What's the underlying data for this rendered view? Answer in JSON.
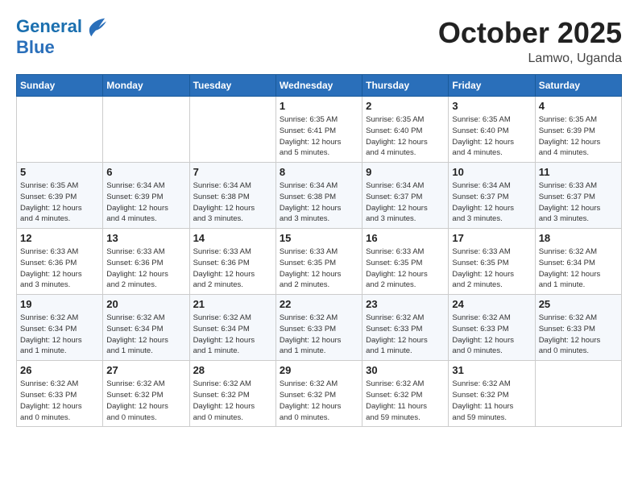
{
  "header": {
    "logo_line1": "General",
    "logo_line2": "Blue",
    "month": "October 2025",
    "location": "Lamwo, Uganda"
  },
  "days_of_week": [
    "Sunday",
    "Monday",
    "Tuesday",
    "Wednesday",
    "Thursday",
    "Friday",
    "Saturday"
  ],
  "weeks": [
    [
      {
        "day": "",
        "info": ""
      },
      {
        "day": "",
        "info": ""
      },
      {
        "day": "",
        "info": ""
      },
      {
        "day": "1",
        "info": "Sunrise: 6:35 AM\nSunset: 6:41 PM\nDaylight: 12 hours\nand 5 minutes."
      },
      {
        "day": "2",
        "info": "Sunrise: 6:35 AM\nSunset: 6:40 PM\nDaylight: 12 hours\nand 4 minutes."
      },
      {
        "day": "3",
        "info": "Sunrise: 6:35 AM\nSunset: 6:40 PM\nDaylight: 12 hours\nand 4 minutes."
      },
      {
        "day": "4",
        "info": "Sunrise: 6:35 AM\nSunset: 6:39 PM\nDaylight: 12 hours\nand 4 minutes."
      }
    ],
    [
      {
        "day": "5",
        "info": "Sunrise: 6:35 AM\nSunset: 6:39 PM\nDaylight: 12 hours\nand 4 minutes."
      },
      {
        "day": "6",
        "info": "Sunrise: 6:34 AM\nSunset: 6:39 PM\nDaylight: 12 hours\nand 4 minutes."
      },
      {
        "day": "7",
        "info": "Sunrise: 6:34 AM\nSunset: 6:38 PM\nDaylight: 12 hours\nand 3 minutes."
      },
      {
        "day": "8",
        "info": "Sunrise: 6:34 AM\nSunset: 6:38 PM\nDaylight: 12 hours\nand 3 minutes."
      },
      {
        "day": "9",
        "info": "Sunrise: 6:34 AM\nSunset: 6:37 PM\nDaylight: 12 hours\nand 3 minutes."
      },
      {
        "day": "10",
        "info": "Sunrise: 6:34 AM\nSunset: 6:37 PM\nDaylight: 12 hours\nand 3 minutes."
      },
      {
        "day": "11",
        "info": "Sunrise: 6:33 AM\nSunset: 6:37 PM\nDaylight: 12 hours\nand 3 minutes."
      }
    ],
    [
      {
        "day": "12",
        "info": "Sunrise: 6:33 AM\nSunset: 6:36 PM\nDaylight: 12 hours\nand 3 minutes."
      },
      {
        "day": "13",
        "info": "Sunrise: 6:33 AM\nSunset: 6:36 PM\nDaylight: 12 hours\nand 2 minutes."
      },
      {
        "day": "14",
        "info": "Sunrise: 6:33 AM\nSunset: 6:36 PM\nDaylight: 12 hours\nand 2 minutes."
      },
      {
        "day": "15",
        "info": "Sunrise: 6:33 AM\nSunset: 6:35 PM\nDaylight: 12 hours\nand 2 minutes."
      },
      {
        "day": "16",
        "info": "Sunrise: 6:33 AM\nSunset: 6:35 PM\nDaylight: 12 hours\nand 2 minutes."
      },
      {
        "day": "17",
        "info": "Sunrise: 6:33 AM\nSunset: 6:35 PM\nDaylight: 12 hours\nand 2 minutes."
      },
      {
        "day": "18",
        "info": "Sunrise: 6:32 AM\nSunset: 6:34 PM\nDaylight: 12 hours\nand 1 minute."
      }
    ],
    [
      {
        "day": "19",
        "info": "Sunrise: 6:32 AM\nSunset: 6:34 PM\nDaylight: 12 hours\nand 1 minute."
      },
      {
        "day": "20",
        "info": "Sunrise: 6:32 AM\nSunset: 6:34 PM\nDaylight: 12 hours\nand 1 minute."
      },
      {
        "day": "21",
        "info": "Sunrise: 6:32 AM\nSunset: 6:34 PM\nDaylight: 12 hours\nand 1 minute."
      },
      {
        "day": "22",
        "info": "Sunrise: 6:32 AM\nSunset: 6:33 PM\nDaylight: 12 hours\nand 1 minute."
      },
      {
        "day": "23",
        "info": "Sunrise: 6:32 AM\nSunset: 6:33 PM\nDaylight: 12 hours\nand 1 minute."
      },
      {
        "day": "24",
        "info": "Sunrise: 6:32 AM\nSunset: 6:33 PM\nDaylight: 12 hours\nand 0 minutes."
      },
      {
        "day": "25",
        "info": "Sunrise: 6:32 AM\nSunset: 6:33 PM\nDaylight: 12 hours\nand 0 minutes."
      }
    ],
    [
      {
        "day": "26",
        "info": "Sunrise: 6:32 AM\nSunset: 6:33 PM\nDaylight: 12 hours\nand 0 minutes."
      },
      {
        "day": "27",
        "info": "Sunrise: 6:32 AM\nSunset: 6:32 PM\nDaylight: 12 hours\nand 0 minutes."
      },
      {
        "day": "28",
        "info": "Sunrise: 6:32 AM\nSunset: 6:32 PM\nDaylight: 12 hours\nand 0 minutes."
      },
      {
        "day": "29",
        "info": "Sunrise: 6:32 AM\nSunset: 6:32 PM\nDaylight: 12 hours\nand 0 minutes."
      },
      {
        "day": "30",
        "info": "Sunrise: 6:32 AM\nSunset: 6:32 PM\nDaylight: 11 hours\nand 59 minutes."
      },
      {
        "day": "31",
        "info": "Sunrise: 6:32 AM\nSunset: 6:32 PM\nDaylight: 11 hours\nand 59 minutes."
      },
      {
        "day": "",
        "info": ""
      }
    ]
  ]
}
